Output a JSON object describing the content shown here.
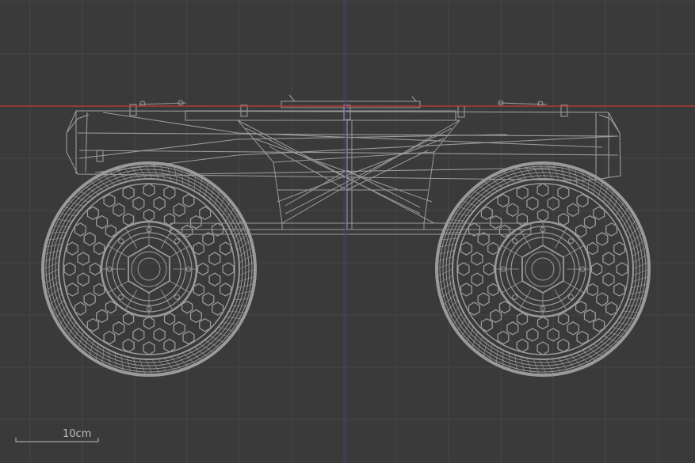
{
  "viewport": {
    "view": "front-orthographic",
    "display_mode": "wireframe",
    "background_color": "#3a3a3a",
    "grid_color": "#474747",
    "wire_color": "#9a9a9a",
    "x_axis_color": "#c23a3a",
    "y_axis_color": "#2f3fb0"
  },
  "scale_bar": {
    "label": "10cm"
  }
}
